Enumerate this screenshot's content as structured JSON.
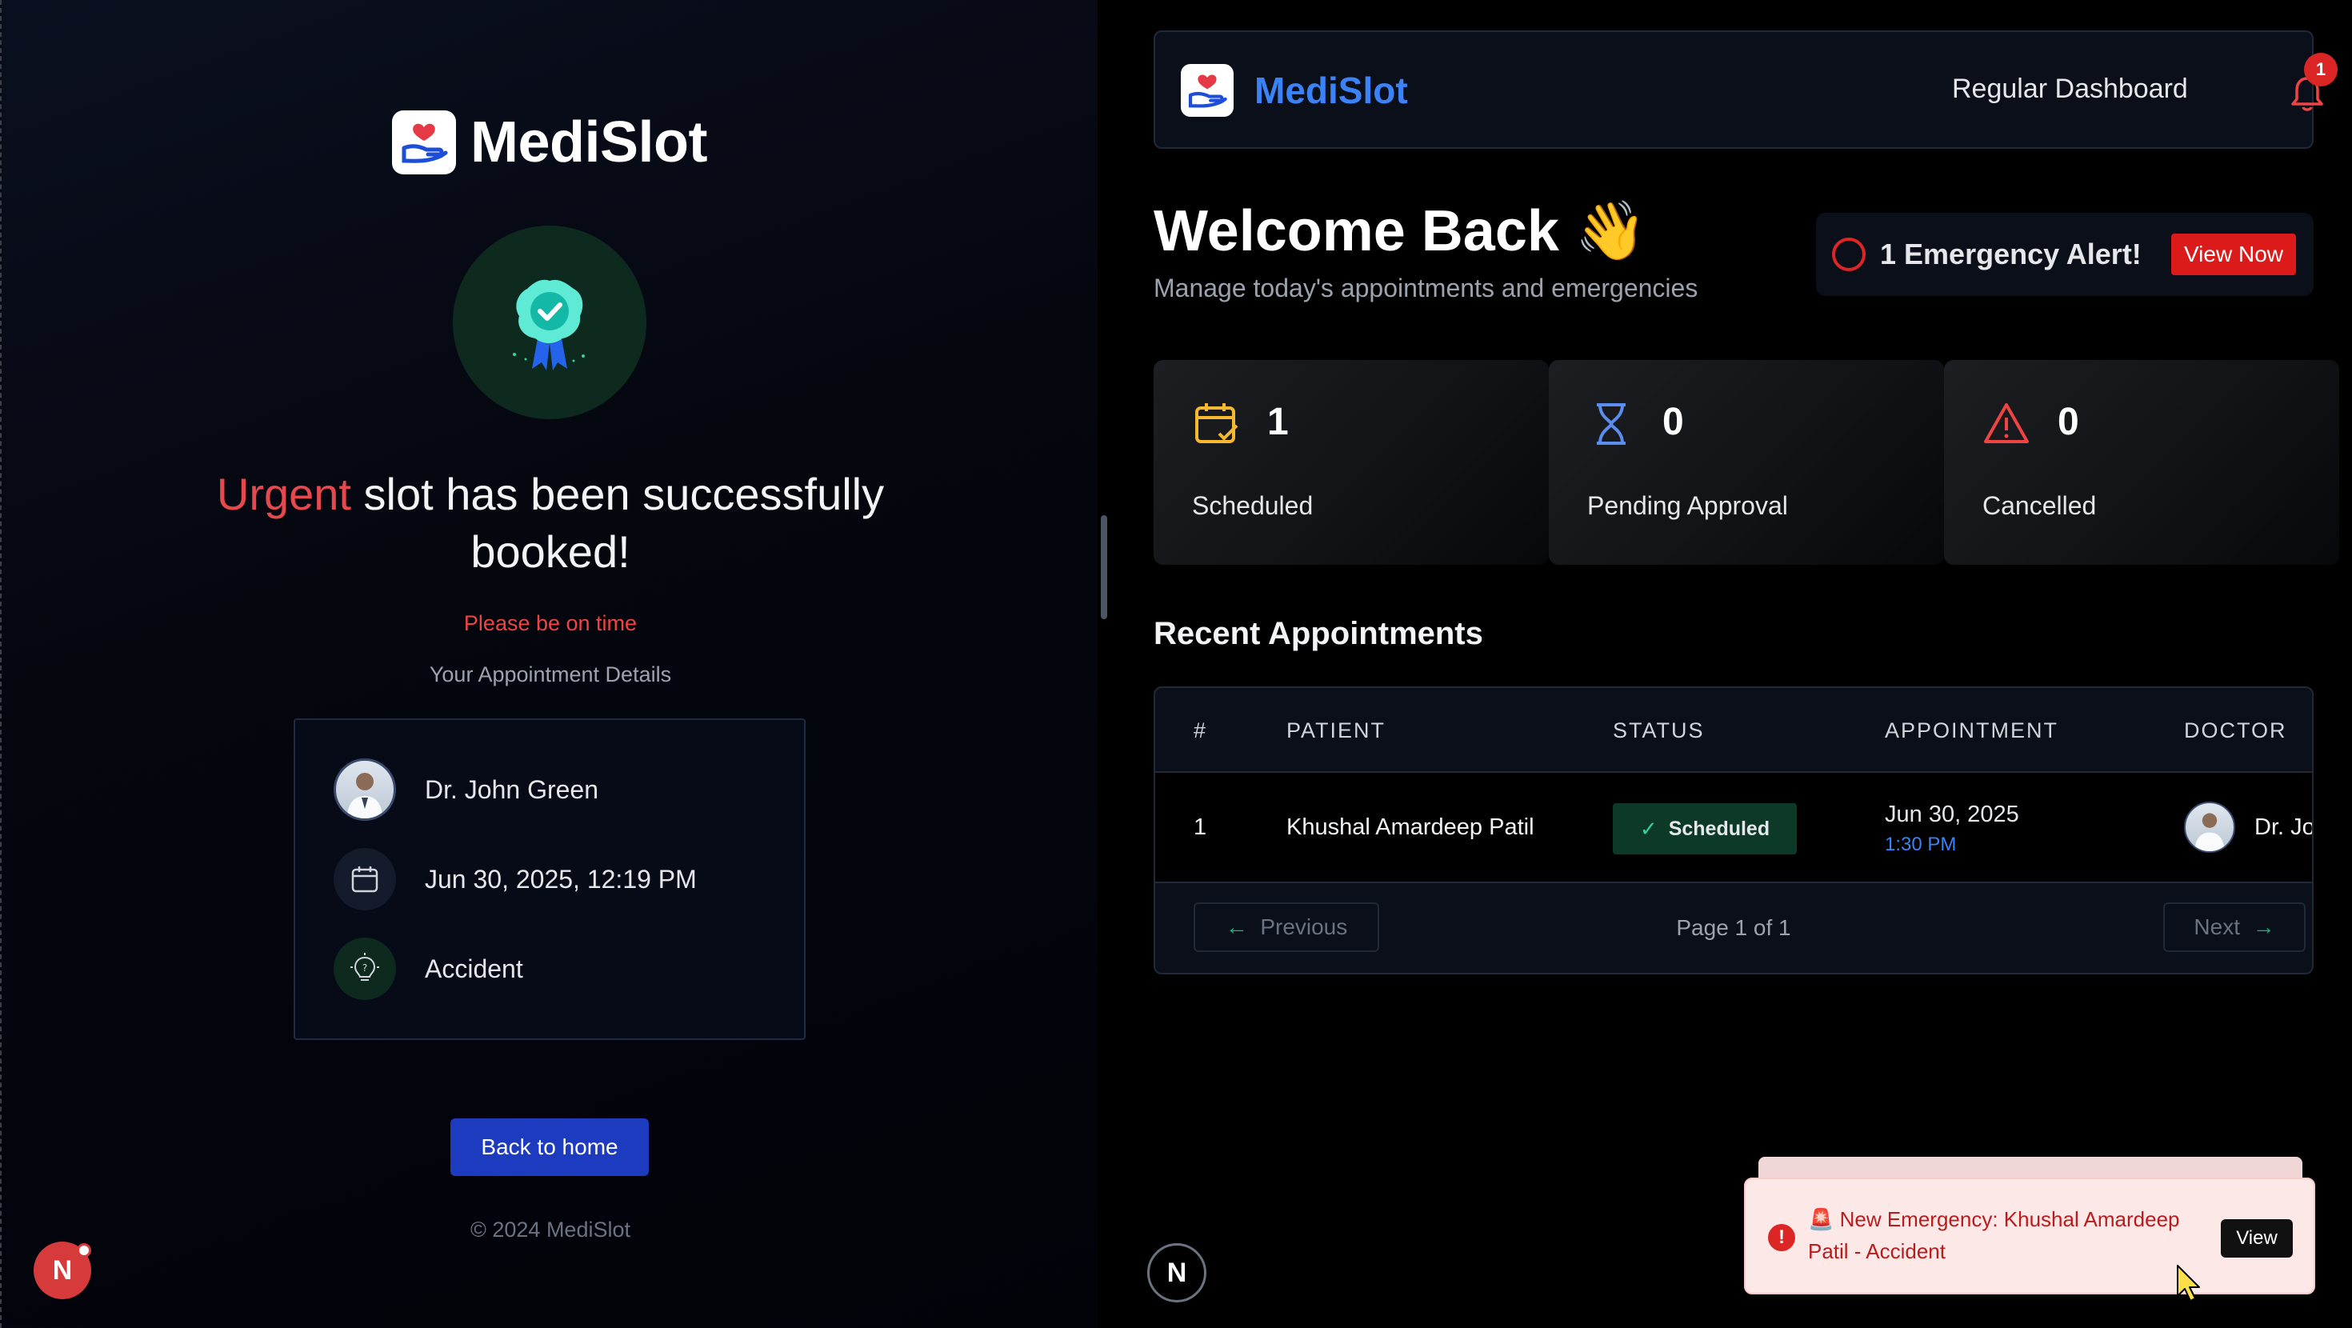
{
  "left": {
    "brand": "MediSlot",
    "title_urgent": "Urgent",
    "title_rest": " slot has been successfully booked!",
    "on_time": "Please be on time",
    "details_label": "Your Appointment Details",
    "doctor": "Dr. John Green",
    "datetime": "Jun 30, 2025, 12:19 PM",
    "reason": "Accident",
    "back_button": "Back to home",
    "copyright": "© 2024 MediSlot",
    "dev_badge": "N"
  },
  "header": {
    "brand": "MediSlot",
    "dashboard_label": "Regular Dashboard",
    "notification_count": "1"
  },
  "welcome": {
    "title": "Welcome Back 👋",
    "subtitle": "Manage today's appointments and emergencies"
  },
  "alert": {
    "text": "1 Emergency Alert!",
    "button": "View Now"
  },
  "stats": [
    {
      "value": "1",
      "label": "Scheduled",
      "icon": "calendar-check-icon",
      "color": "#f5b82e"
    },
    {
      "value": "0",
      "label": "Pending Approval",
      "icon": "hourglass-icon",
      "color": "#5b8def"
    },
    {
      "value": "0",
      "label": "Cancelled",
      "icon": "warning-icon",
      "color": "#ef4444"
    }
  ],
  "recent": {
    "title": "Recent Appointments",
    "columns": [
      "#",
      "PATIENT",
      "STATUS",
      "APPOINTMENT",
      "DOCTOR"
    ],
    "rows": [
      {
        "num": "1",
        "patient": "Khushal Amardeep Patil",
        "status": "Scheduled",
        "date": "Jun 30, 2025",
        "time": "1:30 PM",
        "doctor": "Dr. Jo"
      }
    ],
    "prev": "Previous",
    "next": "Next",
    "page_info": "Page 1 of 1"
  },
  "toast": {
    "message": "🚨 New Emergency: Khushal Amardeep Patil - Accident",
    "button": "View"
  },
  "dev_badge_right": "N",
  "colors": {
    "accent_blue": "#3b82f6",
    "danger": "#dc2626",
    "success_bg": "#0d3a28",
    "button_blue": "#1d3bbf"
  }
}
